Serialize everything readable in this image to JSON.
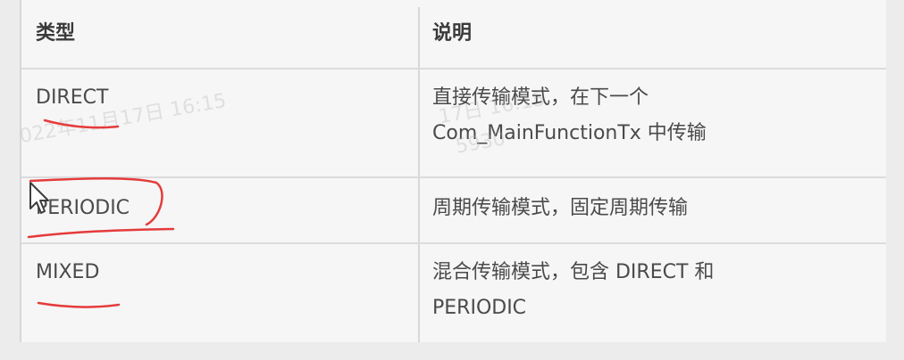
{
  "table": {
    "headers": {
      "type": "类型",
      "description": "说明"
    },
    "rows": [
      {
        "type": "DIRECT",
        "description_lines": [
          "直接传输模式，在下一个",
          "Com_MainFunctionTx 中传输"
        ]
      },
      {
        "type": "PERIODIC",
        "description_lines": [
          "周期传输模式，固定周期传输"
        ]
      },
      {
        "type": "MIXED",
        "description_lines": [
          "混合传输模式，包含 DIRECT 和",
          "PERIODIC"
        ]
      }
    ]
  },
  "watermarks": {
    "left": "022年11月17日 16:15",
    "middle": "17日 16:15",
    "bottom": "5930"
  },
  "annotation_color": "#e53b3b",
  "icons": {
    "cursor": "mouse-pointer-icon"
  }
}
